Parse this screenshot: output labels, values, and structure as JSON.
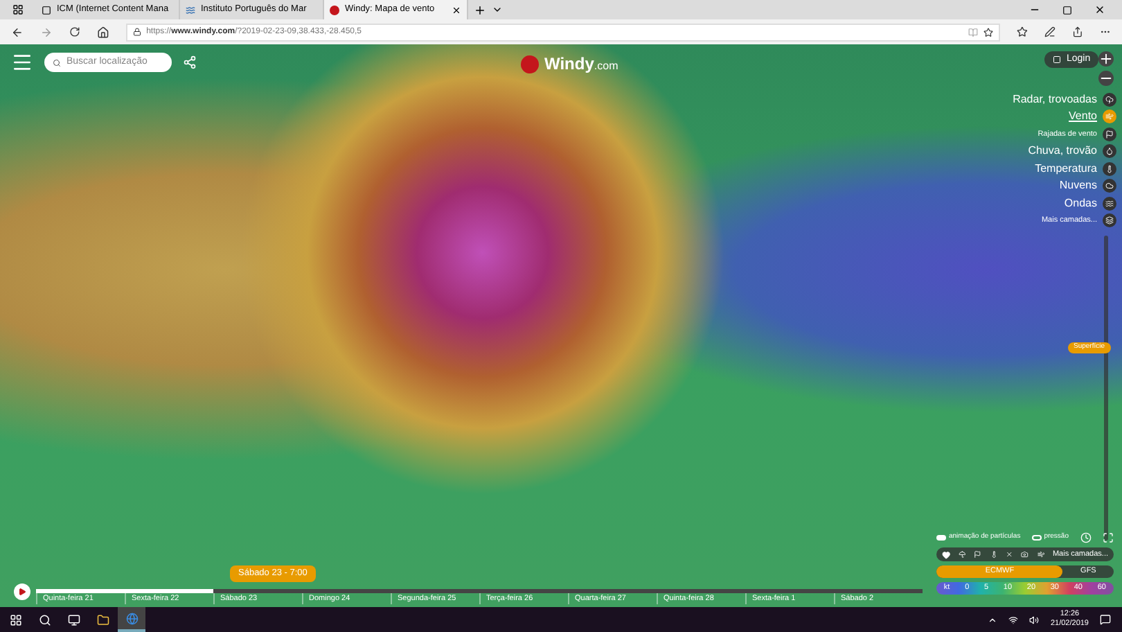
{
  "browser": {
    "tabs": [
      {
        "title": "ICM (Internet Content Mana",
        "selected": false,
        "kind": "page"
      },
      {
        "title": "Instituto Português do Mar",
        "selected": false,
        "kind": "wave"
      },
      {
        "title": "Windy: Mapa de vento",
        "selected": true,
        "kind": "windy"
      }
    ],
    "url_prefix": "https://",
    "url_host": "www.windy.com",
    "url_rest": "/?2019-02-23-09,38.433,-28.450,5"
  },
  "search": {
    "placeholder": "Buscar localização"
  },
  "logo": {
    "name": "Windy",
    "suffix": ".com"
  },
  "login": "Login",
  "layers": [
    {
      "label": "Radar, trovoadas",
      "kind": "big",
      "selected": false
    },
    {
      "label": "Vento",
      "kind": "big",
      "selected": true
    },
    {
      "label": "Rajadas de vento",
      "kind": "small",
      "selected": false
    },
    {
      "label": "Chuva, trovão",
      "kind": "big",
      "selected": false
    },
    {
      "label": "Temperatura",
      "kind": "big",
      "selected": false
    },
    {
      "label": "Nuvens",
      "kind": "big",
      "selected": false
    },
    {
      "label": "Ondas",
      "kind": "big",
      "selected": false
    },
    {
      "label": "Mais camadas...",
      "kind": "small",
      "selected": false
    }
  ],
  "altitude": {
    "label": "Superfície"
  },
  "timeline": {
    "tooltip": "Sábado 23 - 7:00",
    "level": 0.2,
    "days": [
      "Quinta-feira 21",
      "Sexta-feira 22",
      "Sábado 23",
      "Domingo 24",
      "Segunda-feira 25",
      "Terça-feira 26",
      "Quarta-feira 27",
      "Quinta-feira 28",
      "Sexta-feira 1",
      "Sábado 2"
    ]
  },
  "options": [
    {
      "label": "animação de partículas",
      "on": true
    },
    {
      "label": "pressão",
      "on": false
    }
  ],
  "more_layers": "Mais camadas...",
  "models": [
    {
      "label": "ECMWF",
      "selected": true
    },
    {
      "label": "GFS",
      "selected": false
    }
  ],
  "legend": [
    "kt",
    "0",
    "5",
    "10",
    "20",
    "30",
    "40",
    "60"
  ],
  "clock": {
    "time": "12:26",
    "date": "21/02/2019"
  }
}
